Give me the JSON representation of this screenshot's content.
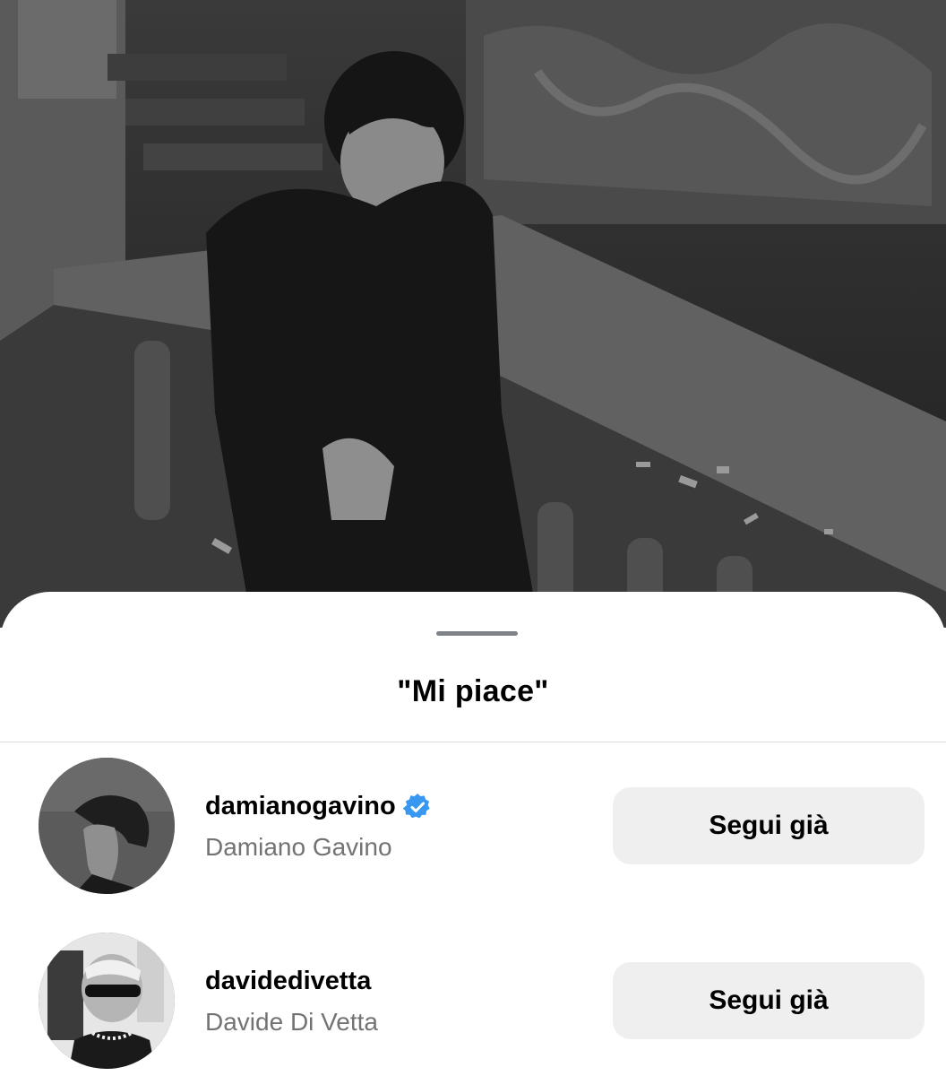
{
  "sheet": {
    "title": "\"Mi piace\""
  },
  "likes": [
    {
      "username": "damianogavino",
      "full_name": "Damiano Gavino",
      "verified": true,
      "button_label": "Segui già",
      "avatar_icon": "avatar-photo"
    },
    {
      "username": "davidedivetta",
      "full_name": "Davide Di Vetta",
      "verified": false,
      "button_label": "Segui già",
      "avatar_icon": "avatar-photo"
    }
  ],
  "colors": {
    "verified_badge": "#3897f0",
    "button_bg": "#efefef",
    "secondary_text": "#737373",
    "grabber": "#7f8287"
  }
}
